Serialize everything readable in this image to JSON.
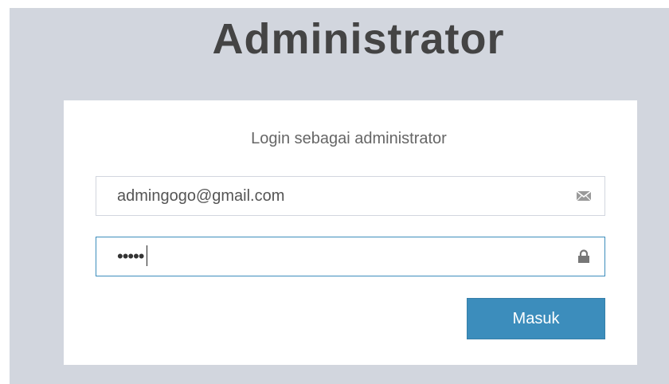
{
  "page": {
    "title": "Administrator",
    "background_color": "#d2d6de"
  },
  "login": {
    "message": "Login sebagai administrator",
    "email_field": {
      "value": "admingogo@gmail.com",
      "icon": "envelope-icon"
    },
    "password_field": {
      "masked_value": "•••••",
      "icon": "lock-icon",
      "focused": true
    },
    "submit_label": "Masuk",
    "accent_color": "#3c8dbc"
  }
}
